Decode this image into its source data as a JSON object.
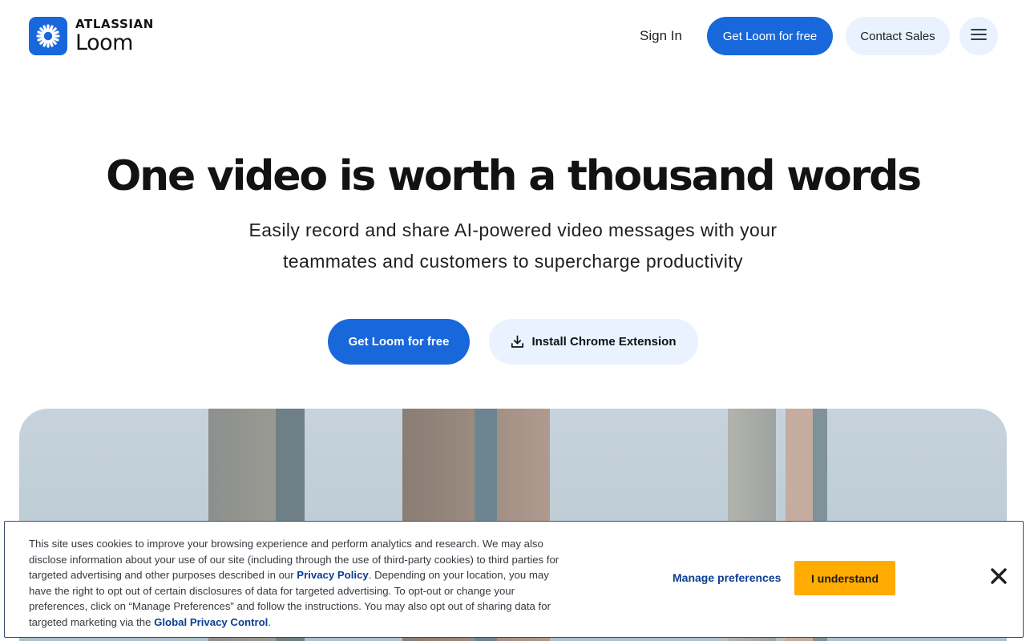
{
  "header": {
    "logo": {
      "brand": "ATLASSIAN",
      "product": "Loom"
    },
    "nav": {
      "sign_in": "Sign In",
      "get_loom": "Get Loom for free",
      "contact_sales": "Contact Sales",
      "menu_icon": "hamburger-menu-icon"
    }
  },
  "hero": {
    "title": "One video is worth a thousand words",
    "subtitle": "Easily record and share AI-powered video messages with your teammates and customers to supercharge productivity",
    "cta_primary": "Get Loom for free",
    "cta_secondary": "Install Chrome Extension",
    "cta_secondary_icon": "download-icon"
  },
  "cookie_banner": {
    "text_part1": "This site uses cookies to improve your browsing experience and perform analytics and research. We may also disclose information about your use of our site (including through the use of third-party cookies) to third parties for targeted advertising and other purposes described in our ",
    "privacy_link": "Privacy Policy",
    "text_part2": ". Depending on your location, you may have the right to opt out of certain disclosures of data for targeted advertising. To opt-out or change your preferences, click on “Manage Preferences” and follow the instructions. You may also opt out of sharing data for targeted marketing via the ",
    "gpc_link": "Global Privacy Control",
    "text_part3": ".",
    "manage_label": "Manage preferences",
    "accept_label": "I understand",
    "close_icon": "close-icon"
  },
  "colors": {
    "brand_blue": "#1868db",
    "light_blue": "#e9f2fe",
    "accept_amber": "#ffab00",
    "link_blue": "#0b3e91"
  }
}
